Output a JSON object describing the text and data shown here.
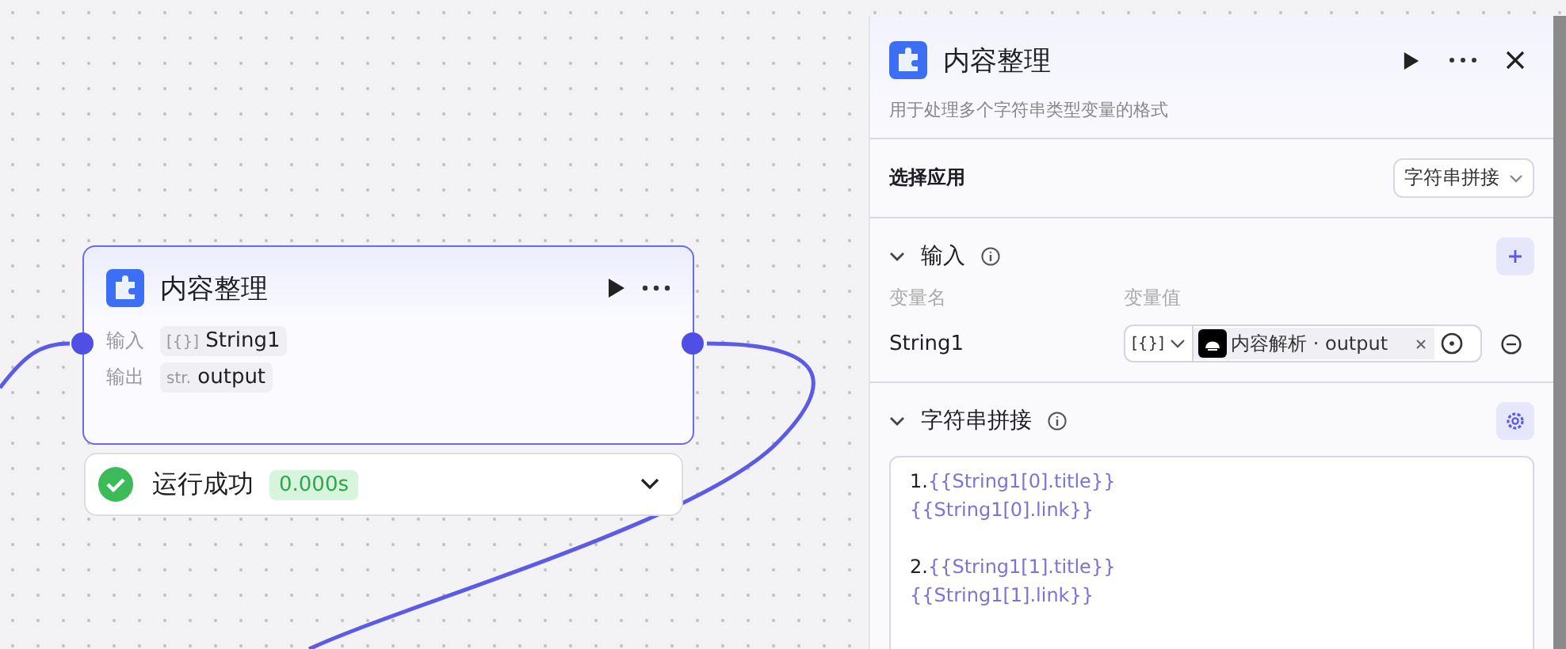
{
  "node": {
    "title": "内容整理",
    "rows": [
      {
        "label": "输入",
        "type_tag": "[{}]",
        "name": "String1"
      },
      {
        "label": "输出",
        "type_tag": "str.",
        "name": "output"
      }
    ]
  },
  "run_status": {
    "text": "运行成功",
    "time": "0.000s"
  },
  "panel": {
    "title": "内容整理",
    "description": "用于处理多个字符串类型变量的格式",
    "app_select": {
      "label": "选择应用",
      "value": "字符串拼接"
    },
    "input_section": {
      "title": "输入",
      "expanded": true,
      "columns": [
        "变量名",
        "变量值"
      ],
      "rows": [
        {
          "name": "String1",
          "type_tag": "[{}]",
          "reference": "内容解析 · output"
        }
      ]
    },
    "concat_section": {
      "title": "字符串拼接",
      "expanded": true,
      "paragraphs": [
        [
          [
            {
              "kind": "text",
              "text": "1."
            },
            {
              "kind": "var",
              "text": "{{String1[0].title}}"
            }
          ],
          [
            {
              "kind": "var",
              "text": "{{String1[0].link}}"
            }
          ]
        ],
        [
          [
            {
              "kind": "text",
              "text": "2."
            },
            {
              "kind": "var",
              "text": "{{String1[1].title}}"
            }
          ],
          [
            {
              "kind": "var",
              "text": "{{String1[1].link}}"
            }
          ]
        ]
      ]
    }
  }
}
